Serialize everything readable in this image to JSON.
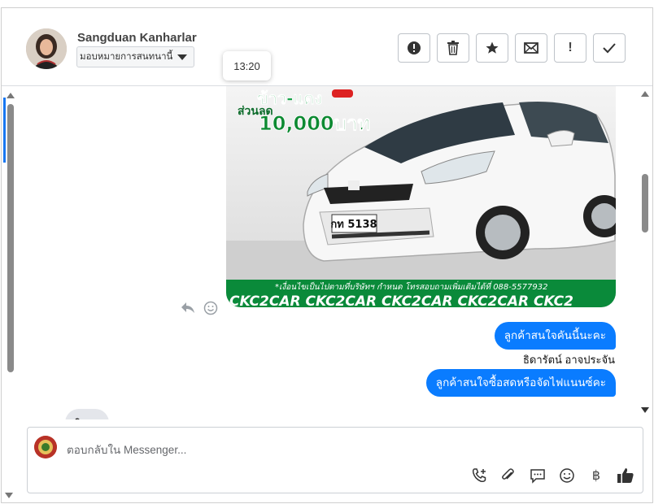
{
  "header": {
    "contact_name": "Sangduan Kanharlar",
    "assign_label": "มอบหมายการสนทนานี้",
    "tooltip_time": "13:20",
    "actions": [
      {
        "icon": "alert-circle-icon",
        "name": "mark-spam-button"
      },
      {
        "icon": "trash-icon",
        "name": "delete-button"
      },
      {
        "icon": "star-icon",
        "name": "star-button"
      },
      {
        "icon": "envelope-icon",
        "name": "mark-unread-button"
      },
      {
        "icon": "exclamation-icon",
        "name": "follow-up-button",
        "glyph": "!"
      },
      {
        "icon": "check-icon",
        "name": "done-button"
      }
    ]
  },
  "image_card": {
    "promo_line1": "ข้าว-แดง",
    "promo_line2": "ส่วนลด",
    "promo_amount": "10,000บาท",
    "plate_text": "กท 5138",
    "footer_text": "*เงื่อนไขเป็นไปตามที่บริษัทฯ กำหนด โทรสอบถามเพิ่มเติมได้ที่ 088-5577932",
    "banner_text": "CKC2CAR CKC2CAR CKC2CAR CKC2CAR CKC2"
  },
  "messages": {
    "outgoing_1": "ลูกค้าสนใจคันนี้นะคะ",
    "sender_name": "ธิดารัตน์ อาจประจัน",
    "outgoing_2": "ลูกค้าสนใจซื้อสดหรือจัดไฟแนนซ์คะ",
    "incoming_1": "ใช่ค่ะ"
  },
  "composer": {
    "placeholder": "ตอบกลับใน Messenger...",
    "currency_glyph": "฿"
  },
  "colors": {
    "accent": "#0a7cff",
    "border": "#dadde1"
  }
}
